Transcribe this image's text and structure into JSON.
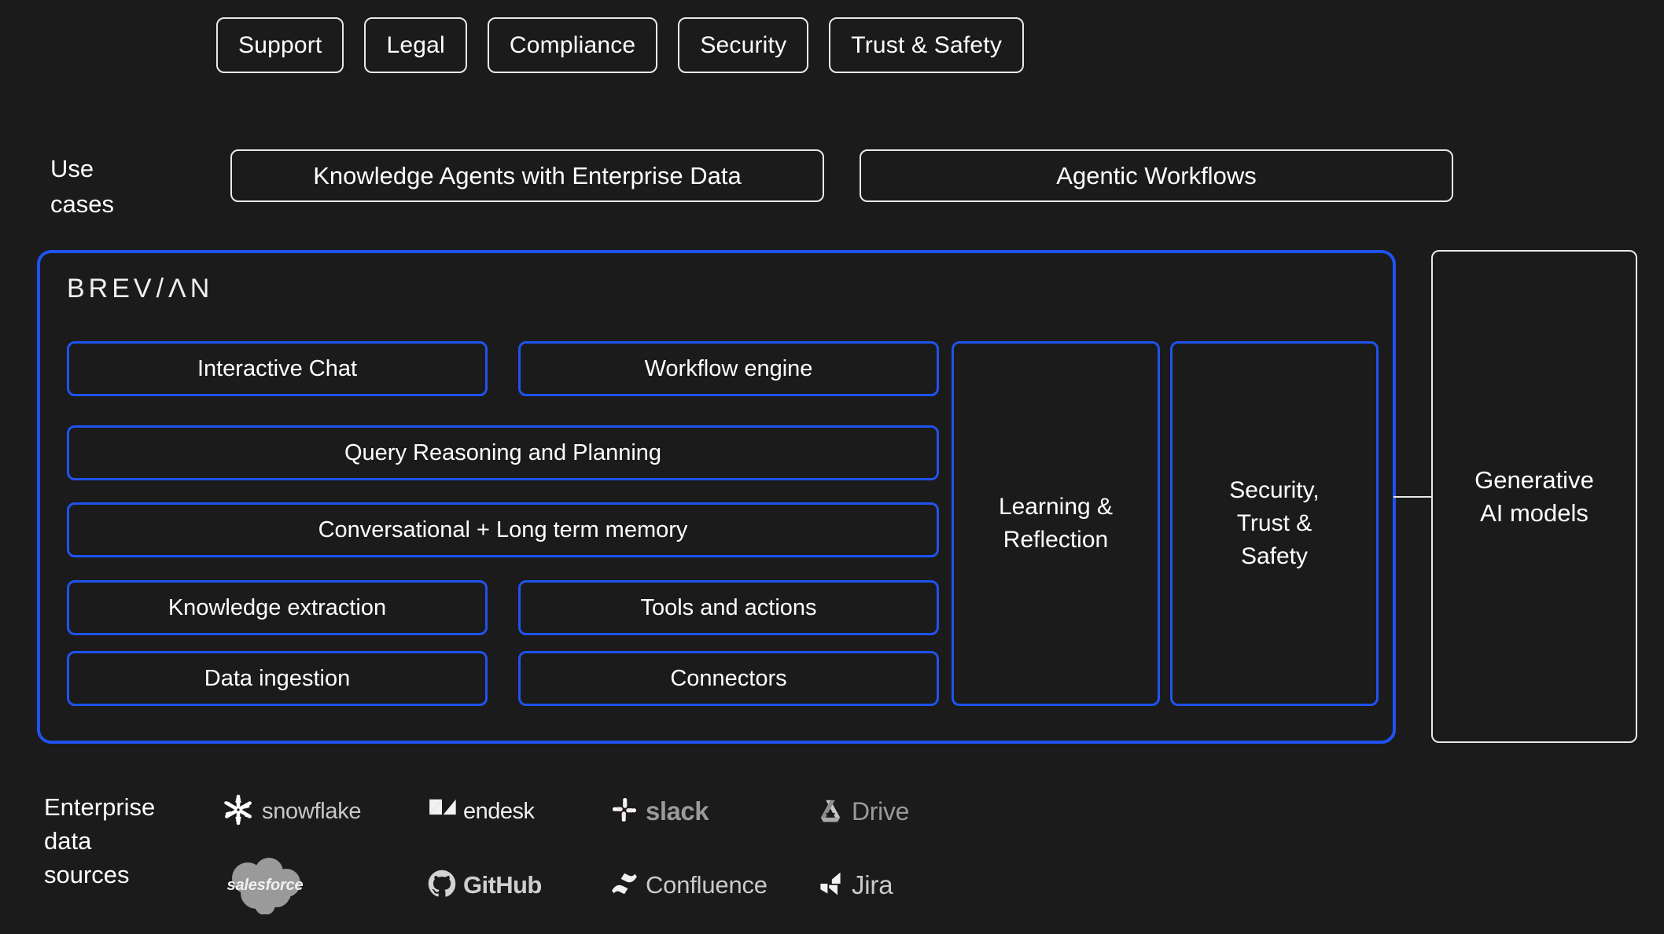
{
  "theme": {
    "background": "#1b1b1b",
    "accent_blue": "#1f53f0",
    "outline_white": "#e9e9e9",
    "text": "#ffffff",
    "logo_grey": "#9b9b9b"
  },
  "personas": [
    {
      "label": "Support"
    },
    {
      "label": "Legal"
    },
    {
      "label": "Compliance"
    },
    {
      "label": "Security"
    },
    {
      "label": "Trust & Safety"
    }
  ],
  "use_cases": {
    "label": "Use\ncases",
    "label_line1": "Use",
    "label_line2": "cases",
    "items": [
      {
        "label": "Knowledge Agents with Enterprise Data"
      },
      {
        "label": "Agentic Workflows"
      }
    ]
  },
  "platform": {
    "brand": "BREV/ΛN",
    "brand_prefix": "BREV",
    "brand_slash": "/",
    "brand_suffix": "ΛN",
    "capabilities": [
      {
        "label": "Interactive Chat"
      },
      {
        "label": "Workflow engine"
      },
      {
        "label": "Query Reasoning and Planning"
      },
      {
        "label": "Conversational + Long term memory"
      },
      {
        "label": "Knowledge extraction"
      },
      {
        "label": "Tools and actions"
      },
      {
        "label": "Data ingestion"
      },
      {
        "label": "Connectors"
      }
    ],
    "side_panels": [
      {
        "label": "Learning &\nReflection",
        "line1": "Learning &",
        "line2": "Reflection"
      },
      {
        "label": "Security,\nTrust &\nSafety",
        "line1": "Security,",
        "line2": "Trust &",
        "line3": "Safety"
      }
    ]
  },
  "models": {
    "label": "Generative\nAI  models",
    "line1": "Generative",
    "line2": "AI  models"
  },
  "enterprise_data_sources": {
    "label_line1": "Enterprise",
    "label_line2": "data",
    "label_line3": "sources",
    "sources": [
      {
        "name": "snowflake",
        "icon": "snowflake-icon"
      },
      {
        "name": "endesk",
        "prefix": "Z",
        "icon": "zendesk-icon"
      },
      {
        "name": "slack",
        "icon": "slack-icon"
      },
      {
        "name": "Drive",
        "icon": "google-drive-icon"
      },
      {
        "name": "salesforce",
        "icon": "salesforce-cloud-icon"
      },
      {
        "name": "GitHub",
        "icon": "github-icon"
      },
      {
        "name": "Confluence",
        "icon": "confluence-icon"
      },
      {
        "name": "Jira",
        "icon": "jira-icon"
      }
    ]
  }
}
